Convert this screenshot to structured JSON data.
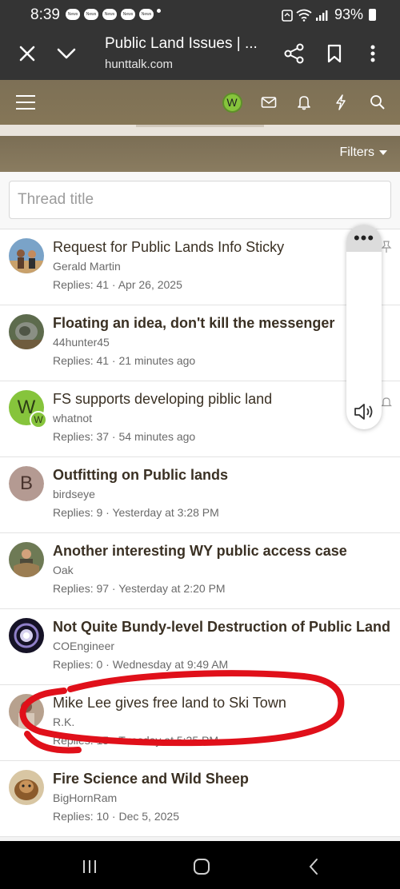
{
  "status_bar": {
    "time": "8:39",
    "notification_label": "News",
    "battery": "93%"
  },
  "browser": {
    "title": "Public Land Issues | ...",
    "url": "hunttalk.com"
  },
  "site_nav": {
    "user_initial": "W",
    "user_color": "#86c43c"
  },
  "filters": {
    "label": "Filters"
  },
  "search": {
    "placeholder": "Thread title"
  },
  "threads": [
    {
      "title": "Request for Public Lands Info Sticky",
      "author": "Gerald Martin",
      "meta": "Replies: 41 · Apr 26, 2025",
      "bold": false
    },
    {
      "title": "Floating an idea, don't kill the messenger",
      "author": "44hunter45",
      "meta": "Replies: 41 · 21 minutes ago",
      "bold": true
    },
    {
      "title": "FS supports developing piblic land",
      "author": "whatnot",
      "meta": "Replies: 37 · 54 minutes ago",
      "bold": false,
      "avatar_letter": "W",
      "avatar_badge": "W"
    },
    {
      "title": "Outfitting on Public lands",
      "author": "birdseye",
      "meta": "Replies: 9 · Yesterday at 3:28 PM",
      "bold": true,
      "avatar_letter": "B"
    },
    {
      "title": "Another interesting WY public access case",
      "author": "Oak",
      "meta": "Replies: 97 · Yesterday at 2:20 PM",
      "bold": true
    },
    {
      "title": "Not Quite Bundy-level Destruction of Public Land",
      "author": "COEngineer",
      "meta": "Replies: 0 · Wednesday at 9:49 AM",
      "bold": true
    },
    {
      "title": "Mike Lee gives free land to Ski Town",
      "author": "R.K.",
      "meta": "Replies: 15 · Tuesday at 5:25 PM",
      "bold": false
    },
    {
      "title": "Fire Science and Wild Sheep",
      "author": "BigHornRam",
      "meta": "Replies: 10 · Dec 5, 2025",
      "bold": true
    }
  ],
  "floating_panel": {
    "more_label": "•••"
  },
  "colors": {
    "site_header": "#7d7056",
    "annotation_circle": "#e0101a",
    "title_text": "#3a3023"
  }
}
